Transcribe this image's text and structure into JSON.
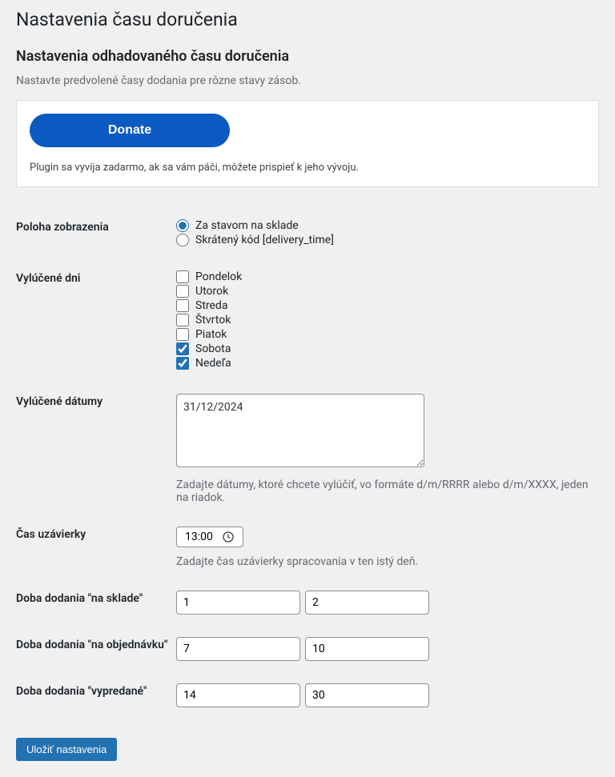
{
  "page_title": "Nastavenia času doručenia",
  "section_title": "Nastavenia odhadovaného času doručenia",
  "section_description": "Nastavte predvolené časy dodania pre rôzne stavy zásob.",
  "donate": {
    "button_label": "Donate",
    "text": "Plugin sa vyvíja zadarmo, ak sa vám páči, môžete prispieť k jeho vývoju."
  },
  "form": {
    "display_position": {
      "label": "Poloha zobrazenia",
      "options": [
        {
          "label": "Za stavom na sklade",
          "checked": true
        },
        {
          "label": "Skrátený kód [delivery_time]",
          "checked": false
        }
      ]
    },
    "excluded_days": {
      "label": "Vylúčené dni",
      "options": [
        {
          "label": "Pondelok",
          "checked": false
        },
        {
          "label": "Utorok",
          "checked": false
        },
        {
          "label": "Streda",
          "checked": false
        },
        {
          "label": "Štvrtok",
          "checked": false
        },
        {
          "label": "Piatok",
          "checked": false
        },
        {
          "label": "Sobota",
          "checked": true
        },
        {
          "label": "Nedeľa",
          "checked": true
        }
      ]
    },
    "excluded_dates": {
      "label": "Vylúčené dátumy",
      "value": "31/12/2024",
      "help": "Zadajte dátumy, ktoré chcete vylúčiť, vo formáte d/m/RRRR alebo d/m/XXXX, jeden na riadok."
    },
    "cutoff_time": {
      "label": "Čas uzávierky",
      "value": "13:00",
      "help": "Zadajte čas uzávierky spracovania v ten istý deň."
    },
    "delivery_instock": {
      "label": "Doba dodania \"na sklade\"",
      "min": "1",
      "max": "2"
    },
    "delivery_backorder": {
      "label": "Doba dodania \"na objednávku\"",
      "min": "7",
      "max": "10"
    },
    "delivery_outofstock": {
      "label": "Doba dodania \"vypredané\"",
      "min": "14",
      "max": "30"
    },
    "submit_label": "Uložiť nastavenia"
  }
}
